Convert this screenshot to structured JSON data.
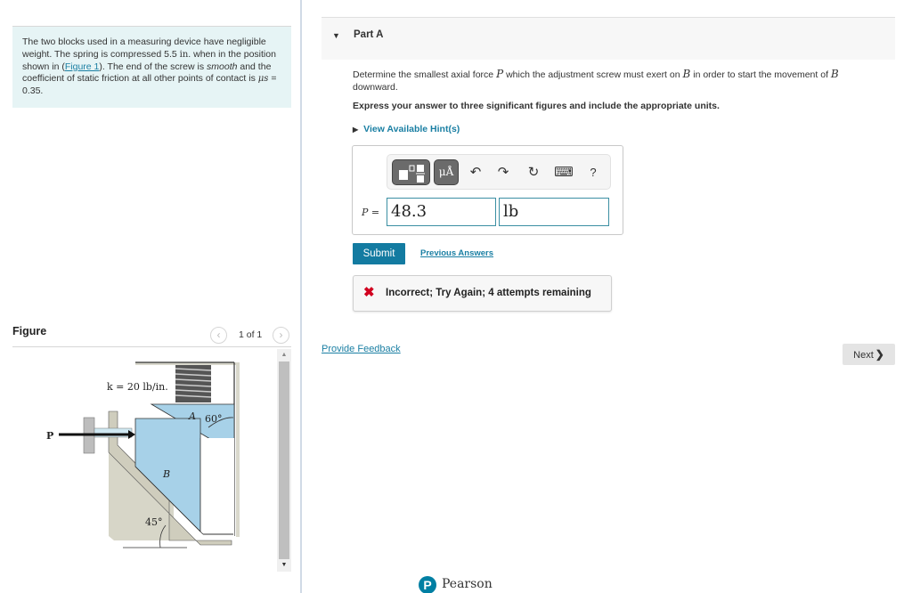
{
  "problem": {
    "intro_part1": "The two blocks used in a measuring device have negligible weight. The spring is compressed 5.5 ",
    "compression_unit": "in",
    "intro_part2": ". when in the position shown in (",
    "figure_link": "Figure 1",
    "intro_part3": "). The end of the screw is ",
    "smooth_word": "smooth",
    "intro_part4": " and the coefficient of static friction at all other points of contact is ",
    "mu_symbol": "μs",
    "intro_part5": " = 0.35."
  },
  "figure": {
    "title": "Figure",
    "pager": "1 of 1",
    "prev_icon": "‹",
    "next_icon": "›",
    "labels": {
      "spring": "k = 20 lb/in.",
      "force": "P",
      "block_a": "A",
      "block_b": "B",
      "angle_a": "60°",
      "angle_b": "45°"
    }
  },
  "part": {
    "caret": "▼",
    "title": "Part A",
    "question_1": "Determine the smallest axial force ",
    "var_p": "P",
    "question_2": " which the adjustment screw must exert on ",
    "var_b": "B",
    "question_3": " in order to start the movement of ",
    "question_4": " downward.",
    "instruction": "Express your answer to three significant figures and include the appropriate units.",
    "hints_label": "View Available Hint(s)"
  },
  "answer": {
    "toolbar": {
      "units_label": "μÅ",
      "undo": "↶",
      "redo": "↷",
      "reset": "↻",
      "keyboard": "⌨",
      "help": "?"
    },
    "label_var": "P",
    "label_eq": " =",
    "value": "48.3",
    "units": "lb"
  },
  "actions": {
    "submit": "Submit",
    "previous_answers": "Previous Answers"
  },
  "feedback": {
    "icon": "✖",
    "message": "Incorrect; Try Again; 4 attempts remaining",
    "attempts_remaining": 4
  },
  "footer": {
    "provide_feedback": "Provide Feedback",
    "next": "Next",
    "next_icon": "❯",
    "brand": "Pearson",
    "brand_mark": "P"
  },
  "colors": {
    "link": "#1a7fa3",
    "submit_bg": "#137ba1",
    "error": "#d1001f",
    "intro_bg": "#e6f4f5",
    "block_fill": "#a7d1e8"
  }
}
